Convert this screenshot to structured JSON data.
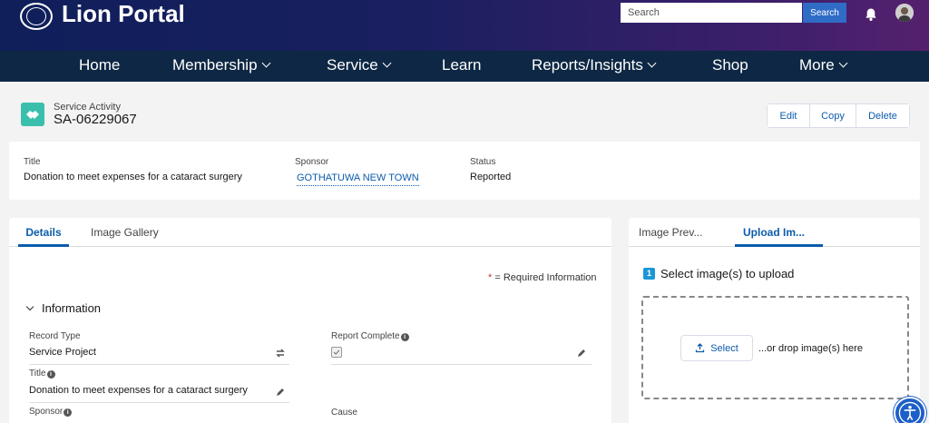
{
  "header": {
    "brand": "Lion Portal",
    "search_placeholder": "Search",
    "search_button": "Search"
  },
  "nav": {
    "items": [
      {
        "label": "Home",
        "dropdown": false
      },
      {
        "label": "Membership",
        "dropdown": true
      },
      {
        "label": "Service",
        "dropdown": true
      },
      {
        "label": "Learn",
        "dropdown": false
      },
      {
        "label": "Reports/Insights",
        "dropdown": true
      },
      {
        "label": "Shop",
        "dropdown": false
      },
      {
        "label": "More",
        "dropdown": true
      }
    ]
  },
  "record": {
    "type": "Service Activity",
    "name": "SA-06229067",
    "actions": [
      "Edit",
      "Copy",
      "Delete"
    ]
  },
  "highlights": {
    "title_label": "Title",
    "title_value": "Donation to meet expenses for a cataract surgery",
    "sponsor_label": "Sponsor",
    "sponsor_value": "GOTHATUWA NEW TOWN",
    "status_label": "Status",
    "status_value": "Reported"
  },
  "details": {
    "tabs": [
      "Details",
      "Image Gallery"
    ],
    "required_note": "= Required Information",
    "section_title": "Information",
    "record_type_label": "Record Type",
    "record_type_value": "Service Project",
    "report_complete_label": "Report Complete",
    "report_complete_checked": true,
    "title_label": "Title",
    "title_value": "Donation to meet expenses for a cataract surgery",
    "sponsor_label": "Sponsor",
    "cause_label": "Cause"
  },
  "upload": {
    "tabs": [
      "Image Prev...",
      "Upload Im..."
    ],
    "step_number": "1",
    "step_title": "Select image(s) to upload",
    "select_button": "Select",
    "drop_text": "...or drop image(s) here"
  },
  "colors": {
    "accent": "#0b5cab",
    "nav_bg": "#0e2744",
    "record_icon": "#3bbfad"
  }
}
